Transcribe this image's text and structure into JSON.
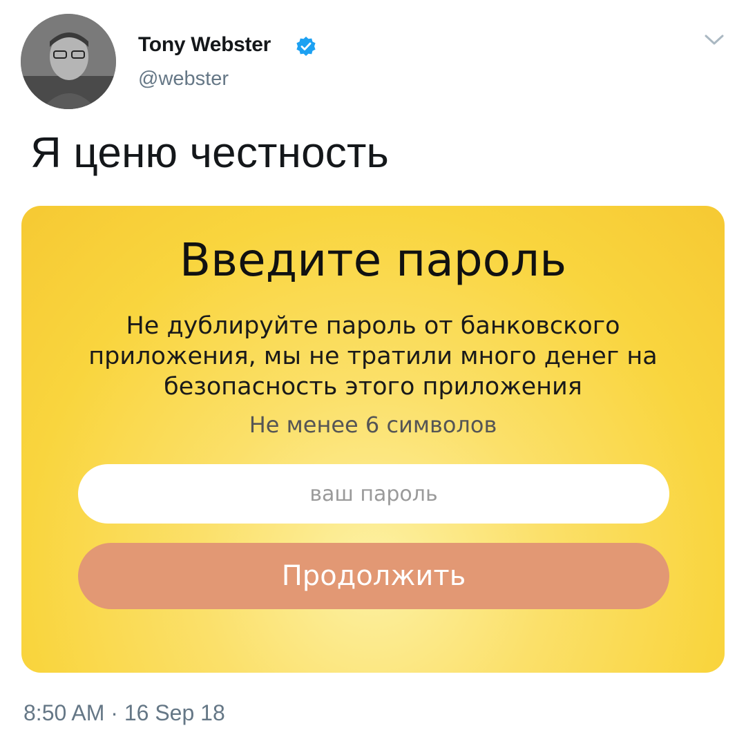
{
  "author": {
    "display_name": "Tony Webster",
    "handle": "@webster",
    "verified": true
  },
  "tweet": {
    "text": "Я ценю честность",
    "timestamp": "8:50 AM · 16 Sep 18"
  },
  "card": {
    "title": "Введите пароль",
    "description": "Не дублируйте пароль от банковского приложения, мы не тратили много денег на безопасность этого приложения",
    "hint": "Не менее 6 символов",
    "input_placeholder": "ваш пароль",
    "button_label": "Продолжить"
  },
  "colors": {
    "verified_badge": "#1da1f2",
    "card_background": "#f9d53e",
    "button": "#e29874",
    "secondary_text": "#657786"
  },
  "icons": {
    "verified": "verified-badge-icon",
    "caret": "chevron-down-icon"
  }
}
